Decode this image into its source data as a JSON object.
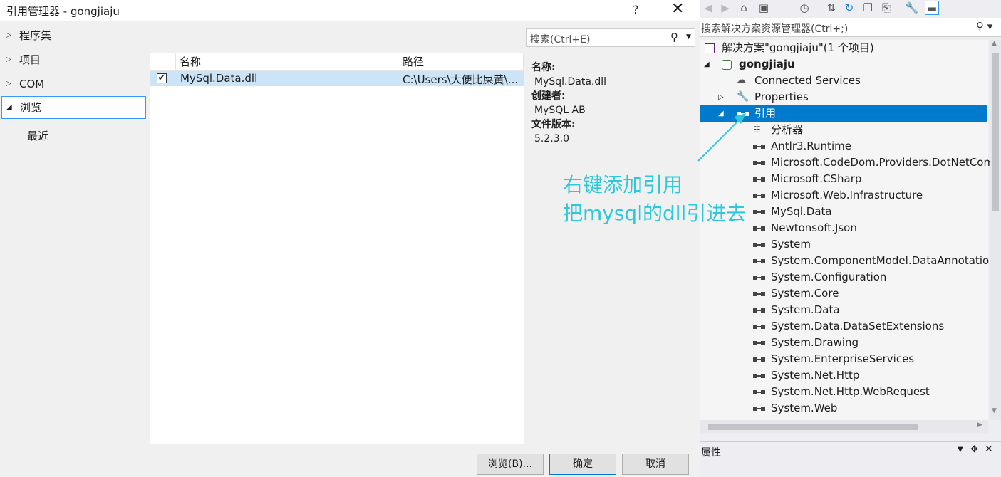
{
  "dialog": {
    "title": "引用管理器 - gongjiaju",
    "help_glyph": "?",
    "close_glyph": "✕",
    "nav": [
      {
        "label": "程序集",
        "expanded": false
      },
      {
        "label": "项目",
        "expanded": false
      },
      {
        "label": "COM",
        "expanded": false
      },
      {
        "label": "浏览",
        "expanded": true
      },
      {
        "label": "最近"
      }
    ],
    "search_placeholder": "搜索(Ctrl+E)",
    "columns": [
      "名称",
      "路径"
    ],
    "rows": [
      {
        "checked": true,
        "name": "MySql.Data.dll",
        "path": "C:\\Users\\大便比屎黄\\..."
      }
    ],
    "details": {
      "name_label": "名称:",
      "name_value": "MySql.Data.dll",
      "creator_label": "创建者:",
      "creator_value": "MySQL AB",
      "version_label": "文件版本:",
      "version_value": "5.2.3.0"
    },
    "buttons": {
      "browse": "浏览(B)...",
      "ok": "确定",
      "cancel": "取消"
    }
  },
  "solution_explorer": {
    "search_placeholder": "搜索解决方案资源管理器(Ctrl+;)",
    "solution": "解决方案\"gongjiaju\"(1 个项目)",
    "project": "gongjiaju",
    "connected_services": "Connected Services",
    "properties": "Properties",
    "references": "引用",
    "analyzers": "分析器",
    "refs": [
      "Antlr3.Runtime",
      "Microsoft.CodeDom.Providers.DotNetCompilerPlatform",
      "Microsoft.CSharp",
      "Microsoft.Web.Infrastructure",
      "MySql.Data",
      "Newtonsoft.Json",
      "System",
      "System.ComponentModel.DataAnnotations",
      "System.Configuration",
      "System.Core",
      "System.Data",
      "System.Data.DataSetExtensions",
      "System.Drawing",
      "System.EnterpriseServices",
      "System.Net.Http",
      "System.Net.Http.WebRequest",
      "System.Web"
    ],
    "properties_panel_title": "属性"
  },
  "annotation": {
    "line1": "右键添加引用",
    "line2": "把mysql的dll引进去",
    "color": "#2dc8dc"
  }
}
